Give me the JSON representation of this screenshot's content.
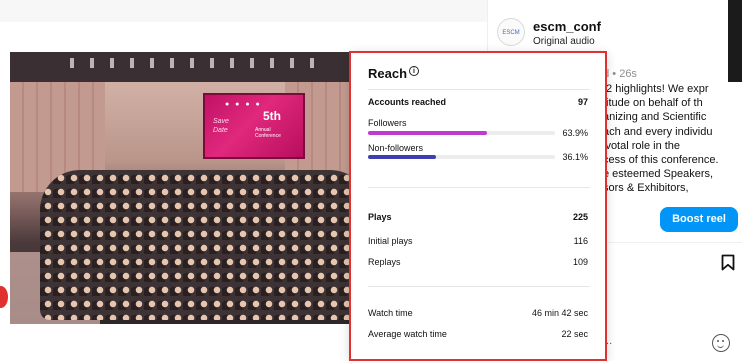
{
  "post": {
    "username": "escm_conf",
    "audio": "Original audio",
    "avatar_text": "ESCM",
    "caption_meta": "ed • 26s",
    "caption_lines": [
      " 2 highlights! We expr",
      "titude on behalf of th",
      "anizing and Scientific",
      "ach and every individu",
      "ivotal role in the",
      "cess of this conference.",
      "e esteemed Speakers,",
      "sors & Exhibitors,"
    ],
    "boost_label": "Boost reel",
    "comment_placeholder": "...",
    "icons": {
      "bookmark": "bookmark-icon",
      "emoji": "emoji-icon",
      "info": "info-icon"
    }
  },
  "reach": {
    "title": "Reach",
    "info_symbol": "i",
    "accounts_label": "Accounts reached",
    "accounts_value": "97",
    "followers_label": "Followers",
    "followers_value": "63.9%",
    "followers_fraction": 0.639,
    "nonfollowers_label": "Non-followers",
    "nonfollowers_value": "36.1%",
    "nonfollowers_fraction": 0.361,
    "plays_label": "Plays",
    "plays_value": "225",
    "initial_label": "Initial plays",
    "initial_value": "116",
    "replays_label": "Replays",
    "replays_value": "109",
    "watch_label": "Watch time",
    "watch_value": "46 min 42 sec",
    "avg_label": "Average watch time",
    "avg_value": "22 sec"
  },
  "colors": {
    "followers_bar": "#c13ad0",
    "nonfollowers_bar": "#3f3fb0",
    "highlight_border": "#e03131",
    "boost_button": "#0095f6"
  }
}
